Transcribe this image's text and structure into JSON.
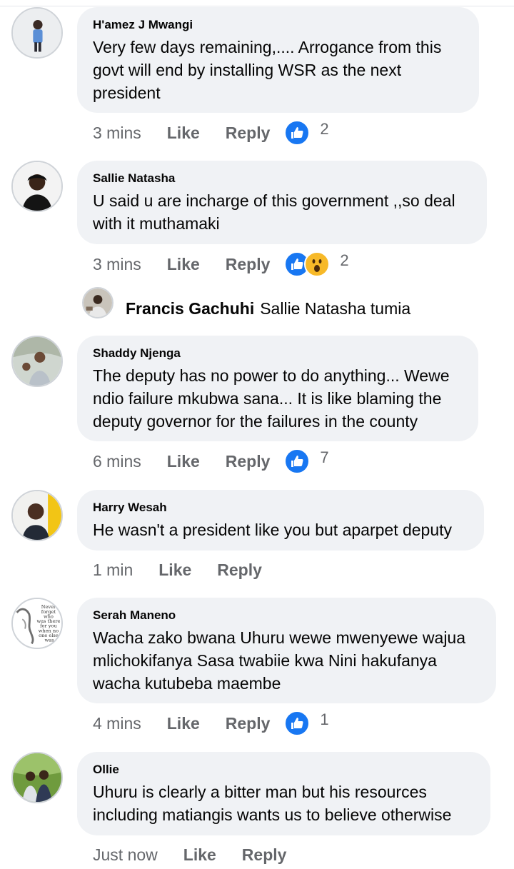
{
  "comments": [
    {
      "author": "H'amez J Mwangi",
      "text": "Very few days remaining,.... Arrogance from this govt will end by installing WSR as the next president",
      "time": "3 mins",
      "like": "Like",
      "reply": "Reply",
      "reactions": [
        "like-icon"
      ],
      "count": "2"
    },
    {
      "author": "Sallie Natasha",
      "text": "U said u are incharge of this government ,,so deal with it muthamaki",
      "time": "3 mins",
      "like": "Like",
      "reply": "Reply",
      "reactions": [
        "like-icon",
        "wow-icon"
      ],
      "count": "2",
      "replies_preview": {
        "author": "Francis Gachuhi",
        "text": "Sallie Natasha tumia"
      }
    },
    {
      "author": "Shaddy Njenga",
      "text": "The deputy has no power to do anything... Wewe ndio failure mkubwa sana... It is like blaming the deputy governor for the failures in the county",
      "time": "6 mins",
      "like": "Like",
      "reply": "Reply",
      "reactions": [
        "like-icon"
      ],
      "count": "7"
    },
    {
      "author": "Harry Wesah",
      "text": "He wasn't a president like you but aparpet deputy",
      "time": "1 min",
      "like": "Like",
      "reply": "Reply",
      "reactions": [],
      "count": ""
    },
    {
      "author": "Serah Maneno",
      "text": "Wacha zako bwana Uhuru wewe mwenyewe wajua mlichokifanya Sasa twabiie kwa Nini hakufanya wacha kutubeba maembe",
      "time": "4 mins",
      "like": "Like",
      "reply": "Reply",
      "reactions": [
        "like-icon"
      ],
      "count": "1",
      "avatar_text": "Never forget who was there for you when no one else was"
    },
    {
      "author": "Ollie",
      "text": "Uhuru is clearly a bitter man but his resources including matiangis wants us to believe otherwise",
      "time": "Just now",
      "like": "Like",
      "reply": "Reply",
      "reactions": [],
      "count": ""
    }
  ],
  "colors": {
    "like": "#1877f2",
    "wow": "#f7b928",
    "bubble": "#f0f2f5",
    "meta": "#65676b"
  }
}
